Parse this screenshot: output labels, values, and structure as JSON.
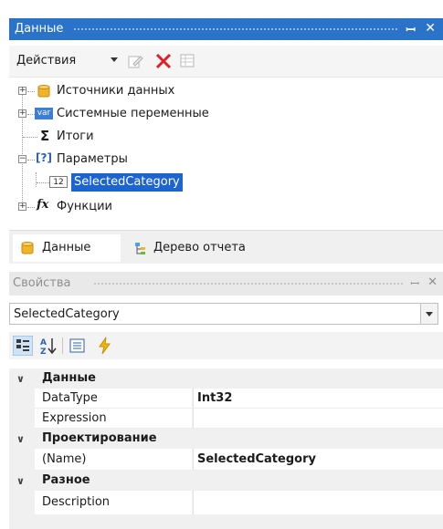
{
  "data_panel": {
    "title": "Данные",
    "actions_label": "Действия",
    "tree": [
      {
        "label": "Источники данных",
        "icon": "database-icon"
      },
      {
        "label": "Системные переменные",
        "icon": "var-icon",
        "icon_text": "var"
      },
      {
        "label": "Итоги",
        "icon": "sigma-icon",
        "icon_text": "Σ"
      },
      {
        "label": "Параметры",
        "icon": "parameters-icon",
        "icon_text": "[?]"
      },
      {
        "label": "SelectedCategory",
        "icon": "int-param-icon",
        "icon_text": "12",
        "selected": true
      },
      {
        "label": "Функции",
        "icon": "function-icon",
        "icon_text": "fx"
      }
    ],
    "tabs": [
      {
        "label": "Данные",
        "active": true
      },
      {
        "label": "Дерево отчета"
      }
    ]
  },
  "properties_panel": {
    "title": "Свойства",
    "object_selector": "SelectedCategory",
    "categories": [
      {
        "name": "Данные",
        "props": [
          {
            "name": "DataType",
            "value": "Int32"
          },
          {
            "name": "Expression",
            "value": ""
          }
        ]
      },
      {
        "name": "Проектирование",
        "props": [
          {
            "name": "(Name)",
            "value": "SelectedCategory"
          }
        ]
      },
      {
        "name": "Разное",
        "props": [
          {
            "name": "Description",
            "value": ""
          }
        ]
      }
    ]
  },
  "colors": {
    "title_bar": "#2b73c9",
    "selection": "#1e64d0",
    "delete_icon": "#e02020"
  }
}
